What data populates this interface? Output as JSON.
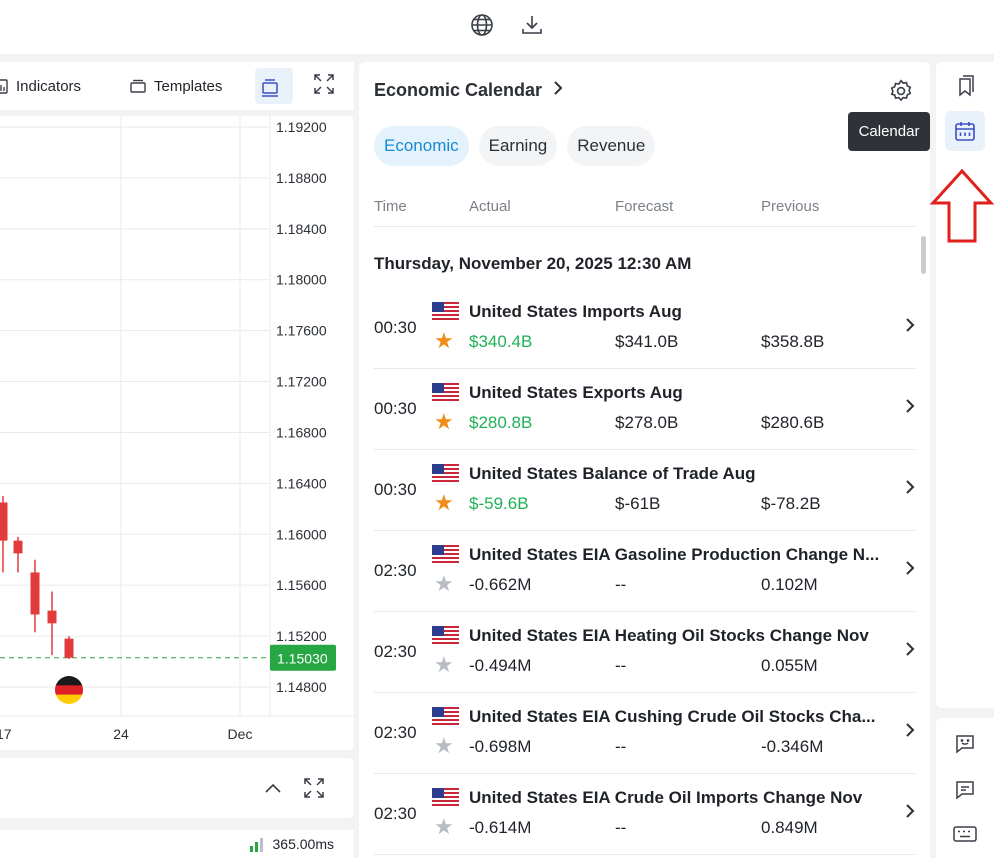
{
  "topbar": {
    "icons": [
      "globe-icon",
      "download-icon"
    ]
  },
  "chart_toolbar": {
    "indicators_label": "Indicators",
    "templates_label": "Templates"
  },
  "chart_data": {
    "type": "candlestick",
    "y_ticks": [
      "1.19200",
      "1.18800",
      "1.18400",
      "1.18000",
      "1.17600",
      "1.17200",
      "1.16800",
      "1.16400",
      "1.16000",
      "1.15600",
      "1.15200",
      "1.14800"
    ],
    "current_price": "1.15030",
    "x_ticks": [
      "17",
      "24",
      "Dec"
    ],
    "ylim": [
      1.146,
      1.194
    ],
    "candles": [
      {
        "open": 1.1625,
        "close": 1.1595,
        "high": 1.163,
        "low": 1.157
      },
      {
        "open": 1.1595,
        "close": 1.1585,
        "high": 1.1598,
        "low": 1.157
      },
      {
        "open": 1.157,
        "close": 1.1537,
        "high": 1.158,
        "low": 1.1523
      },
      {
        "open": 1.154,
        "close": 1.153,
        "high": 1.1555,
        "low": 1.1505
      },
      {
        "open": 1.1518,
        "close": 1.1503,
        "high": 1.152,
        "low": 1.1502
      }
    ],
    "colors": {
      "down": "#e23b3b",
      "price_tag": "#27a644",
      "grid": "#e9eaed"
    }
  },
  "bottom_panel": {},
  "status": {
    "latency": "365.00ms"
  },
  "calendar": {
    "title": "Economic Calendar",
    "tabs": [
      {
        "label": "Economic",
        "active": true
      },
      {
        "label": "Earning",
        "active": false
      },
      {
        "label": "Revenue",
        "active": false
      }
    ],
    "columns": {
      "time": "Time",
      "actual": "Actual",
      "forecast": "Forecast",
      "previous": "Previous"
    },
    "date_header": "Thursday, November 20, 2025 12:30 AM",
    "events": [
      {
        "time": "00:30",
        "name": "United States Imports Aug",
        "actual": "$340.4B",
        "forecast": "$341.0B",
        "previous": "$358.8B",
        "starred": true,
        "actual_color": "#1fb157"
      },
      {
        "time": "00:30",
        "name": "United States Exports Aug",
        "actual": "$280.8B",
        "forecast": "$278.0B",
        "previous": "$280.6B",
        "starred": true,
        "actual_color": "#1fb157"
      },
      {
        "time": "00:30",
        "name": "United States Balance of Trade Aug",
        "actual": "$-59.6B",
        "forecast": "$-61B",
        "previous": "$-78.2B",
        "starred": true,
        "actual_color": "#1fb157"
      },
      {
        "time": "02:30",
        "name": "United States EIA Gasoline Production Change N...",
        "actual": "-0.662M",
        "forecast": "--",
        "previous": "0.102M",
        "starred": false,
        "actual_color": "#1f2329"
      },
      {
        "time": "02:30",
        "name": "United States EIA Heating Oil Stocks Change Nov",
        "actual": "-0.494M",
        "forecast": "--",
        "previous": "0.055M",
        "starred": false,
        "actual_color": "#1f2329"
      },
      {
        "time": "02:30",
        "name": "United States EIA Cushing Crude Oil Stocks Cha...",
        "actual": "-0.698M",
        "forecast": "--",
        "previous": "-0.346M",
        "starred": false,
        "actual_color": "#1f2329"
      },
      {
        "time": "02:30",
        "name": "United States EIA Crude Oil Imports Change Nov",
        "actual": "-0.614M",
        "forecast": "--",
        "previous": "0.849M",
        "starred": false,
        "actual_color": "#1f2329"
      }
    ]
  },
  "sidebar": {
    "tooltip": "Calendar",
    "buttons": [
      "bookmark-icon",
      "calendar-icon"
    ],
    "bottom_buttons": [
      "chat-smile-icon",
      "message-icon",
      "keyboard-icon"
    ],
    "accent": "#3b4ec8",
    "annotation_color": "#e0201b"
  }
}
